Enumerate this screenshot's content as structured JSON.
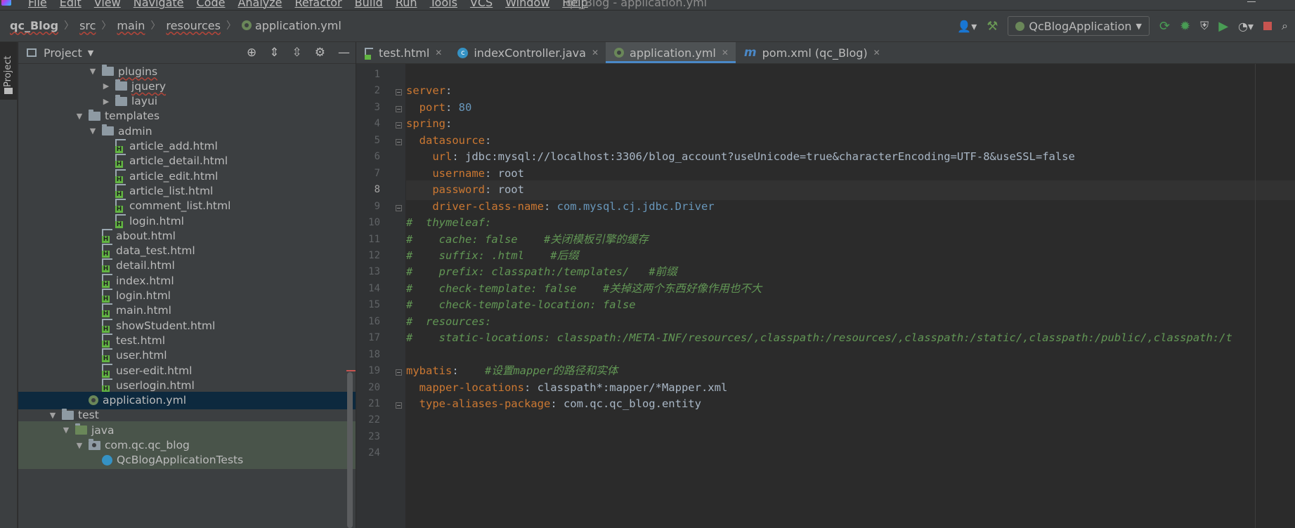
{
  "menubar": {
    "items": [
      "File",
      "Edit",
      "View",
      "Navigate",
      "Code",
      "Analyze",
      "Refactor",
      "Build",
      "Run",
      "Tools",
      "VCS",
      "Window",
      "Help"
    ],
    "window_title": "qc_Blog - application.yml"
  },
  "breadcrumb": {
    "items": [
      "qc_Blog",
      "src",
      "main",
      "resources"
    ],
    "file": "application.yml"
  },
  "toolbar": {
    "run_config": "QcBlogApplication"
  },
  "left_stripe": {
    "label": "Project"
  },
  "project_panel": {
    "title": "Project",
    "tree": [
      {
        "label": "plugins",
        "indent": 5,
        "arrow": "down",
        "icon": "folder",
        "wavy": true
      },
      {
        "label": "jquery",
        "indent": 6,
        "arrow": "right",
        "icon": "folder",
        "wavy": true
      },
      {
        "label": "layui",
        "indent": 6,
        "arrow": "right",
        "icon": "folder",
        "wavy": false
      },
      {
        "label": "templates",
        "indent": 4,
        "arrow": "down",
        "icon": "folder",
        "wavy": false
      },
      {
        "label": "admin",
        "indent": 5,
        "arrow": "down",
        "icon": "folder",
        "wavy": false
      },
      {
        "label": "article_add.html",
        "indent": 6,
        "arrow": "none",
        "icon": "html",
        "wavy": false
      },
      {
        "label": "article_detail.html",
        "indent": 6,
        "arrow": "none",
        "icon": "html",
        "wavy": false
      },
      {
        "label": "article_edit.html",
        "indent": 6,
        "arrow": "none",
        "icon": "html",
        "wavy": false
      },
      {
        "label": "article_list.html",
        "indent": 6,
        "arrow": "none",
        "icon": "html",
        "wavy": false
      },
      {
        "label": "comment_list.html",
        "indent": 6,
        "arrow": "none",
        "icon": "html",
        "wavy": false
      },
      {
        "label": "login.html",
        "indent": 6,
        "arrow": "none",
        "icon": "html",
        "wavy": false
      },
      {
        "label": "about.html",
        "indent": 5,
        "arrow": "none",
        "icon": "html",
        "wavy": false
      },
      {
        "label": "data_test.html",
        "indent": 5,
        "arrow": "none",
        "icon": "html",
        "wavy": false
      },
      {
        "label": "detail.html",
        "indent": 5,
        "arrow": "none",
        "icon": "html",
        "wavy": false
      },
      {
        "label": "index.html",
        "indent": 5,
        "arrow": "none",
        "icon": "html",
        "wavy": false
      },
      {
        "label": "login.html",
        "indent": 5,
        "arrow": "none",
        "icon": "html",
        "wavy": false
      },
      {
        "label": "main.html",
        "indent": 5,
        "arrow": "none",
        "icon": "html",
        "wavy": false
      },
      {
        "label": "showStudent.html",
        "indent": 5,
        "arrow": "none",
        "icon": "html",
        "wavy": false
      },
      {
        "label": "test.html",
        "indent": 5,
        "arrow": "none",
        "icon": "html",
        "wavy": false
      },
      {
        "label": "user.html",
        "indent": 5,
        "arrow": "none",
        "icon": "html",
        "wavy": false
      },
      {
        "label": "user-edit.html",
        "indent": 5,
        "arrow": "none",
        "icon": "html",
        "wavy": false
      },
      {
        "label": "userlogin.html",
        "indent": 5,
        "arrow": "none",
        "icon": "html",
        "wavy": false
      },
      {
        "label": "application.yml",
        "indent": 4,
        "arrow": "none",
        "icon": "spring",
        "wavy": false,
        "selected": true
      },
      {
        "label": "test",
        "indent": 2,
        "arrow": "down",
        "icon": "folder",
        "wavy": false
      },
      {
        "label": "java",
        "indent": 3,
        "arrow": "down",
        "icon": "folder-green",
        "wavy": false,
        "test": true
      },
      {
        "label": "com.qc.qc_blog",
        "indent": 4,
        "arrow": "down",
        "icon": "package",
        "wavy": false,
        "test": true
      },
      {
        "label": "QcBlogApplicationTests",
        "indent": 5,
        "arrow": "none",
        "icon": "java-class",
        "wavy": false,
        "test": true
      }
    ]
  },
  "editor": {
    "tabs": [
      {
        "label": "test.html",
        "icon": "html",
        "active": false
      },
      {
        "label": "indexController.java",
        "icon": "class",
        "active": false
      },
      {
        "label": "application.yml",
        "icon": "spring",
        "active": true
      },
      {
        "label": "pom.xml (qc_Blog)",
        "icon": "maven",
        "active": false
      }
    ],
    "current_line": 8,
    "lines": [
      {
        "n": "1",
        "fold": "",
        "parts": []
      },
      {
        "n": "2",
        "fold": "open",
        "parts": [
          {
            "t": "server",
            "c": "k"
          },
          {
            "t": ":",
            "c": "v"
          }
        ]
      },
      {
        "n": "3",
        "fold": "close",
        "parts": [
          {
            "t": "  port",
            "c": "k"
          },
          {
            "t": ": ",
            "c": "v"
          },
          {
            "t": "80",
            "c": "n"
          }
        ]
      },
      {
        "n": "4",
        "fold": "open",
        "parts": [
          {
            "t": "spring",
            "c": "k"
          },
          {
            "t": ":",
            "c": "v"
          }
        ]
      },
      {
        "n": "5",
        "fold": "open",
        "parts": [
          {
            "t": "  datasource",
            "c": "k"
          },
          {
            "t": ":",
            "c": "v"
          }
        ]
      },
      {
        "n": "6",
        "fold": "",
        "parts": [
          {
            "t": "    url",
            "c": "k"
          },
          {
            "t": ": jdbc:mysql://localhost:3306/blog_account?useUnicode=true&characterEncoding=UTF-8&useSSL=false",
            "c": "v"
          }
        ]
      },
      {
        "n": "7",
        "fold": "",
        "parts": [
          {
            "t": "    username",
            "c": "k"
          },
          {
            "t": ": root",
            "c": "v"
          }
        ]
      },
      {
        "n": "8",
        "fold": "",
        "parts": [
          {
            "t": "    password",
            "c": "k"
          },
          {
            "t": ": root",
            "c": "v"
          }
        ]
      },
      {
        "n": "9",
        "fold": "close",
        "parts": [
          {
            "t": "    driver-class-name",
            "c": "k"
          },
          {
            "t": ": ",
            "c": "v"
          },
          {
            "t": "com.mysql.cj.jdbc.Driver",
            "c": "cls"
          }
        ]
      },
      {
        "n": "10",
        "fold": "",
        "parts": [
          {
            "t": "#  thymeleaf:",
            "c": "c"
          }
        ]
      },
      {
        "n": "11",
        "fold": "",
        "parts": [
          {
            "t": "#    cache: false    #关闭模板引擎的缓存",
            "c": "c"
          }
        ]
      },
      {
        "n": "12",
        "fold": "",
        "parts": [
          {
            "t": "#    suffix: .html    #后缀",
            "c": "c"
          }
        ]
      },
      {
        "n": "13",
        "fold": "",
        "parts": [
          {
            "t": "#    prefix: classpath:/templates/   #前缀",
            "c": "c"
          }
        ]
      },
      {
        "n": "14",
        "fold": "",
        "parts": [
          {
            "t": "#    check-template: false    #关掉这两个东西好像作用也不大",
            "c": "c"
          }
        ]
      },
      {
        "n": "15",
        "fold": "",
        "parts": [
          {
            "t": "#    check-template-location: false",
            "c": "c"
          }
        ]
      },
      {
        "n": "16",
        "fold": "",
        "parts": [
          {
            "t": "#  resources:",
            "c": "c"
          }
        ]
      },
      {
        "n": "17",
        "fold": "",
        "parts": [
          {
            "t": "#    static-locations: classpath:/META-INF/resources/,classpath:/resources/,classpath:/static/,classpath:/public/,classpath:/t",
            "c": "c"
          }
        ]
      },
      {
        "n": "18",
        "fold": "",
        "parts": []
      },
      {
        "n": "19",
        "fold": "open",
        "parts": [
          {
            "t": "mybatis",
            "c": "k"
          },
          {
            "t": ":    ",
            "c": "v"
          },
          {
            "t": "#设置mapper的路径和实体",
            "c": "c"
          }
        ]
      },
      {
        "n": "20",
        "fold": "",
        "parts": [
          {
            "t": "  mapper-locations",
            "c": "k"
          },
          {
            "t": ": classpath*:mapper/*Mapper.xml",
            "c": "v"
          }
        ]
      },
      {
        "n": "21",
        "fold": "close",
        "parts": [
          {
            "t": "  type-aliases-package",
            "c": "k"
          },
          {
            "t": ": com.qc.qc_blog.entity",
            "c": "v"
          }
        ]
      },
      {
        "n": "22",
        "fold": "",
        "parts": []
      },
      {
        "n": "23",
        "fold": "",
        "parts": []
      },
      {
        "n": "24",
        "fold": "",
        "parts": []
      }
    ]
  },
  "colors": {
    "keyword": "#cc7832",
    "number": "#6897bb",
    "comment": "#629755",
    "selection": "#0d293e",
    "test_source": "#49544a",
    "accent": "#4a88c7"
  }
}
